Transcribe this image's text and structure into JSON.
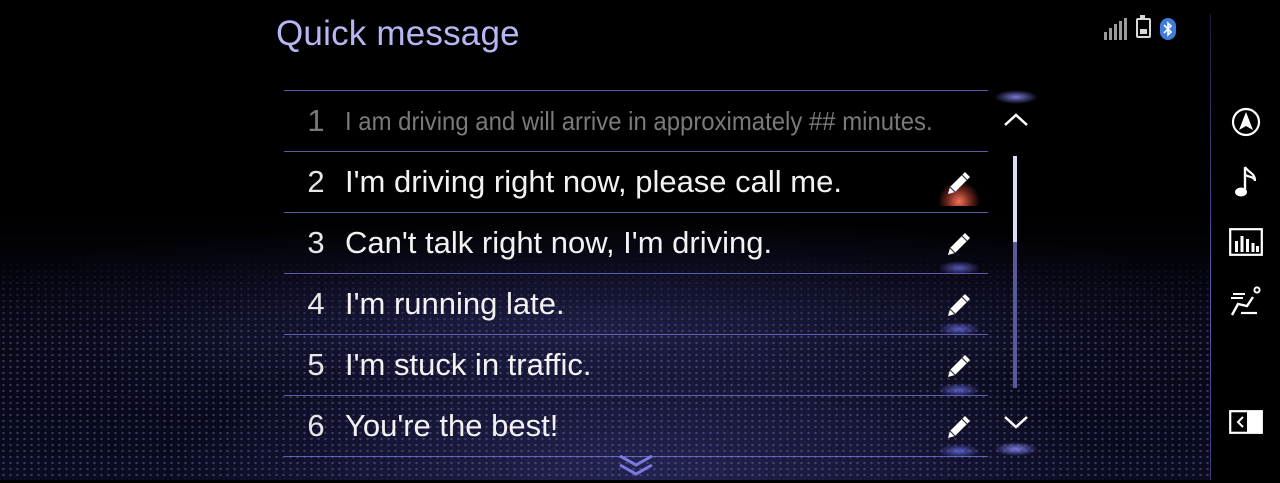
{
  "header": {
    "title": "Quick message"
  },
  "status_bar": {
    "signal_icon": "signal-strength-icon",
    "battery_icon": "battery-icon",
    "bluetooth_icon": "bluetooth-icon",
    "bluetooth_color": "#3c7ddd"
  },
  "messages": [
    {
      "number": "1",
      "text": "I am driving and will arrive in approximately ## minutes.",
      "editable": false
    },
    {
      "number": "2",
      "text": "I'm driving right now, please call me.",
      "editable": true,
      "edit_highlighted": true
    },
    {
      "number": "3",
      "text": "Can't talk right now, I'm driving.",
      "editable": true
    },
    {
      "number": "4",
      "text": "I'm running late.",
      "editable": true
    },
    {
      "number": "5",
      "text": "I'm stuck in traffic.",
      "editable": true
    },
    {
      "number": "6",
      "text": "You're the best!",
      "editable": true
    }
  ],
  "scroll": {
    "thumb_fraction": 0.37,
    "up_icon": "chevron-up-icon",
    "down_icon": "chevron-down-icon",
    "more_icon": "double-chevron-down-icon"
  },
  "side_menu": [
    {
      "name": "navigation-icon"
    },
    {
      "name": "music-note-icon"
    },
    {
      "name": "audio-equalizer-icon"
    },
    {
      "name": "climate-seat-icon"
    },
    {
      "name": "screen-split-icon"
    }
  ],
  "colors": {
    "title": "#b6b6f2",
    "divider": "#7878dc",
    "accent_highlight": "#ff7a5a",
    "disabled_text": "#7a7a7a"
  }
}
